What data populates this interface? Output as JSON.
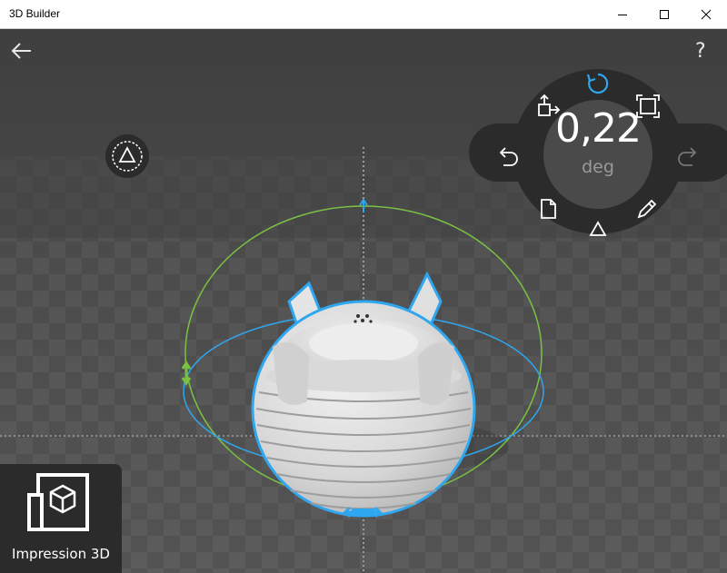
{
  "window": {
    "title": "3D Builder"
  },
  "toolbar": {
    "help_label": "?"
  },
  "hud": {
    "value": "0,22",
    "unit": "deg",
    "mode": "rotate"
  },
  "print_tile": {
    "label": "Impression 3D"
  },
  "colors": {
    "selection_outline": "#2ea6f0",
    "rotation_ring_green": "#7ac143",
    "rotation_ring_blue": "#2ea6f0",
    "hud_background": "#2b2b2b",
    "hud_center": "#4a4a4a",
    "active_icon": "#2ea6f0"
  },
  "icons": [
    "back-arrow-icon",
    "help-icon",
    "triangle-mode-icon",
    "rotate-icon",
    "move-icon",
    "scale-icon",
    "undo-icon",
    "redo-icon",
    "document-icon",
    "pencil-icon",
    "triangle-icon",
    "3d-print-icon"
  ]
}
